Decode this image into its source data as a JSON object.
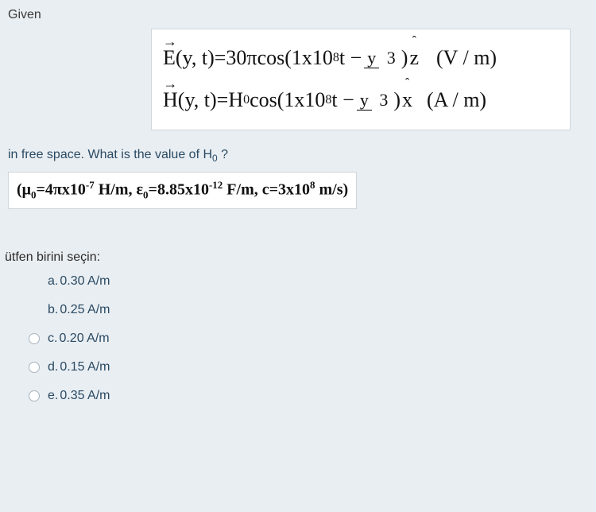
{
  "given_label": "Given",
  "equations": {
    "E": {
      "lhs_sym": "E",
      "args": "(y, t)",
      "eq": " = ",
      "coef": "30π",
      "func": " cos(",
      "freq_mult": "1x10",
      "freq_exp": "8",
      "tminus": "t − ",
      "frac_num": "y",
      "frac_den": "3",
      "close": ")",
      "unit_vec": "z",
      "units": "(V / m)"
    },
    "H": {
      "lhs_sym": "H",
      "args": "(y, t)",
      "eq": " = ",
      "coef": "H",
      "coef_sub": "0",
      "func": " cos(",
      "freq_mult": "1x10",
      "freq_exp": "8",
      "tminus": "t − ",
      "frac_num": "y",
      "frac_den": "3",
      "close": ")",
      "unit_vec": "x",
      "units": "(A / m)"
    }
  },
  "prompt_line": "in free space. What is the value of H",
  "prompt_sub": "0",
  "prompt_qmark": " ?",
  "constants": {
    "mu_label": "μ",
    "mu_sub": "0",
    "mu_eq": "=4πx10",
    "mu_exp": "-7",
    "mu_unit": " H/m, ",
    "eps_label": "ε",
    "eps_sub": "0",
    "eps_eq": "=8.85x10",
    "eps_exp": "-12",
    "eps_unit": " F/m, ",
    "c_label": "c=3x10",
    "c_exp": "8",
    "c_unit": " m/s)"
  },
  "choose_label": "ütfen birini seçin:",
  "options": [
    {
      "key": "a.",
      "val": "0.30 A/m"
    },
    {
      "key": "b.",
      "val": "0.25 A/m"
    },
    {
      "key": "c.",
      "val": "0.20 A/m"
    },
    {
      "key": "d.",
      "val": "0.15 A/m"
    },
    {
      "key": "e.",
      "val": "0.35 A/m"
    }
  ]
}
